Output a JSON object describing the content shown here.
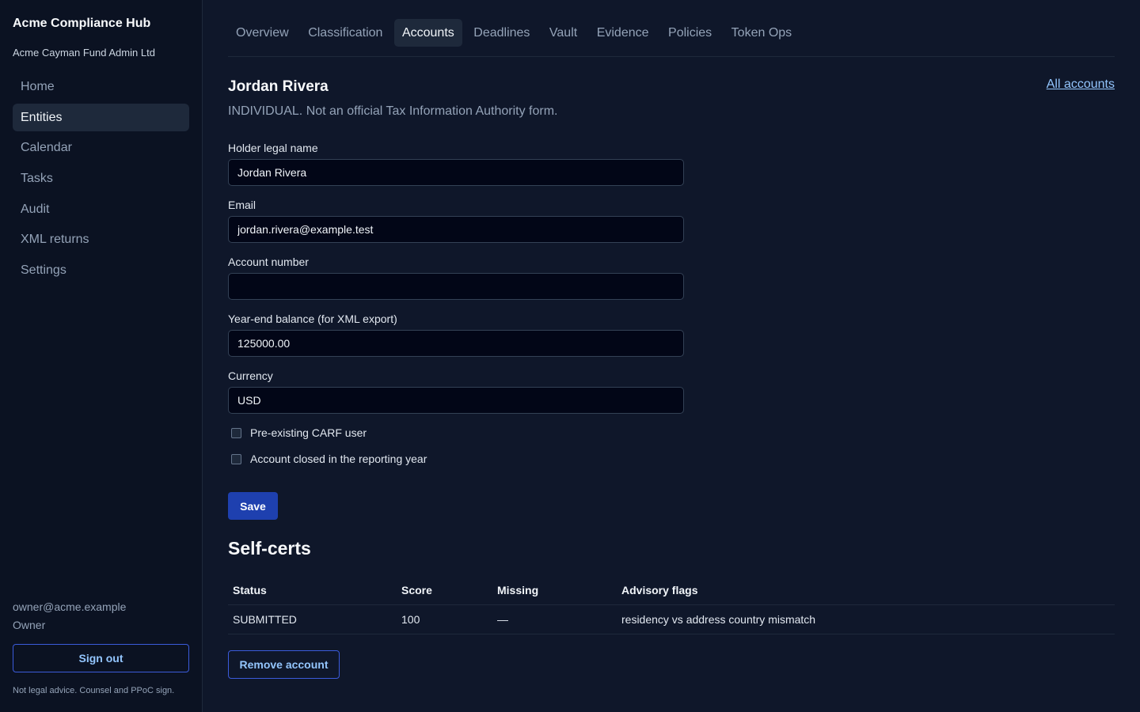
{
  "sidebar": {
    "app_title": "Acme Compliance Hub",
    "org_name": "Acme Cayman Fund Admin Ltd",
    "nav": [
      {
        "label": "Home"
      },
      {
        "label": "Entities"
      },
      {
        "label": "Calendar"
      },
      {
        "label": "Tasks"
      },
      {
        "label": "Audit"
      },
      {
        "label": "XML returns"
      },
      {
        "label": "Settings"
      }
    ],
    "active_nav": "Entities",
    "user_email": "owner@acme.example",
    "user_role": "Owner",
    "signout_label": "Sign out",
    "disclaimer": "Not legal advice. Counsel and PPoC sign."
  },
  "tabs": [
    {
      "label": "Overview"
    },
    {
      "label": "Classification"
    },
    {
      "label": "Accounts"
    },
    {
      "label": "Deadlines"
    },
    {
      "label": "Vault"
    },
    {
      "label": "Evidence"
    },
    {
      "label": "Policies"
    },
    {
      "label": "Token Ops"
    }
  ],
  "active_tab": "Accounts",
  "account": {
    "name": "Jordan Rivera",
    "subtitle": "INDIVIDUAL. Not an official Tax Information Authority form.",
    "all_accounts_link": "All accounts"
  },
  "form": {
    "holder_name": {
      "label": "Holder legal name",
      "value": "Jordan Rivera"
    },
    "email": {
      "label": "Email",
      "value": "jordan.rivera@example.test"
    },
    "account_number": {
      "label": "Account number",
      "value": ""
    },
    "balance": {
      "label": "Year-end balance (for XML export)",
      "value": "125000.00"
    },
    "currency": {
      "label": "Currency",
      "value": "USD"
    },
    "preexisting": {
      "label": "Pre-existing CARF user",
      "checked": false
    },
    "closed": {
      "label": "Account closed in the reporting year",
      "checked": false
    },
    "save_label": "Save"
  },
  "selfcerts": {
    "title": "Self-certs",
    "columns": [
      "Status",
      "Score",
      "Missing",
      "Advisory flags"
    ],
    "rows": [
      [
        "SUBMITTED",
        "100",
        "—",
        "residency vs address country mismatch"
      ]
    ]
  },
  "remove_label": "Remove account"
}
